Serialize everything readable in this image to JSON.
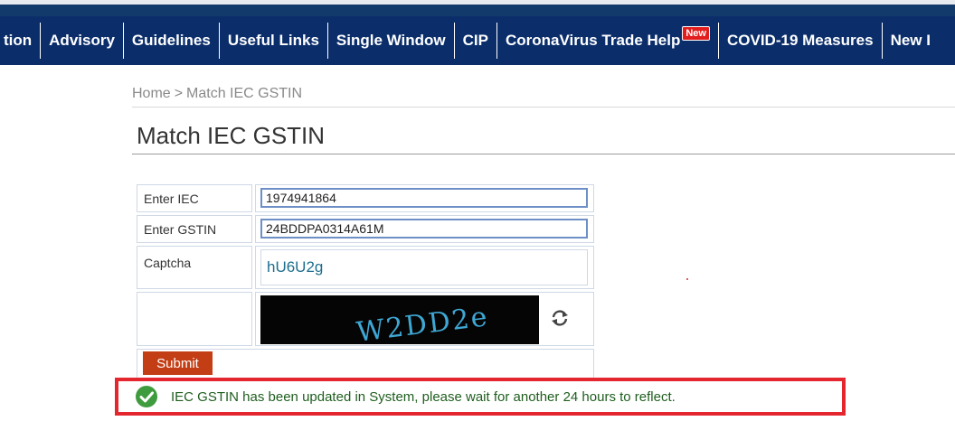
{
  "nav": {
    "items": [
      "tion",
      "Advisory",
      "Guidelines",
      "Useful Links",
      "Single Window",
      "CIP",
      "CoronaVirus Trade Help",
      "COVID-19 Measures",
      "New I"
    ],
    "badge": "New",
    "colors": {
      "background": "#0b2e6b",
      "text": "#ffffff",
      "badge": "#e11d1d"
    }
  },
  "breadcrumb": {
    "home": "Home",
    "separator": ">",
    "current": "Match IEC GSTIN"
  },
  "page": {
    "title": "Match IEC GSTIN"
  },
  "form": {
    "iec_label": "Enter IEC",
    "iec_value": "1974941864",
    "gstin_label": "Enter GSTIN",
    "gstin_value": "24BDDPA0314A61M",
    "captcha_label": "Captcha",
    "captcha_value": "hU6U2g",
    "captcha_image_text": "W2DD2e",
    "refresh_icon": "refresh-icon",
    "submit_label": "Submit",
    "submit_color": "#c43e15"
  },
  "alert": {
    "message": "IEC GSTIN has been updated in System, please wait for another 24 hours to reflect.",
    "icon": "check-circle-icon",
    "icon_color": "#3e9b3e",
    "border_color": "#e4262f",
    "text_color": "#1f5e1f"
  }
}
